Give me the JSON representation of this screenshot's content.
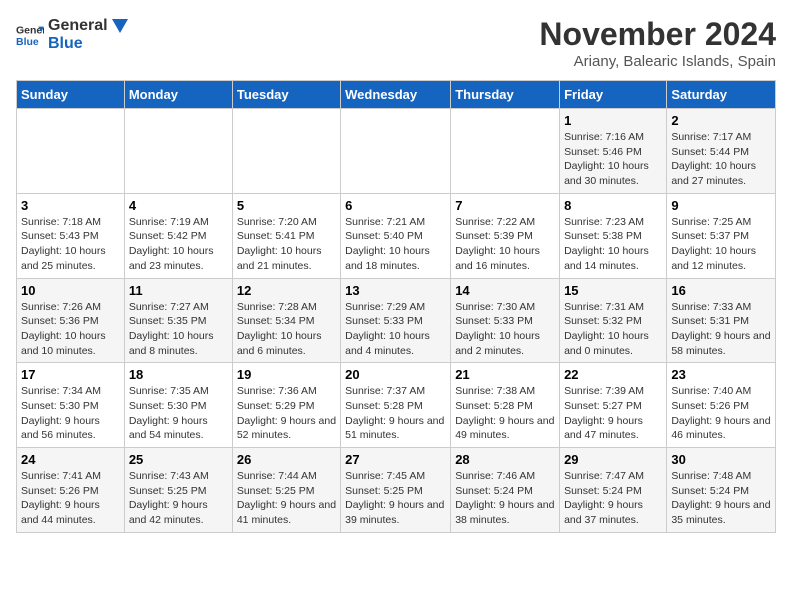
{
  "header": {
    "logo_general": "General",
    "logo_blue": "Blue",
    "month_year": "November 2024",
    "location": "Ariany, Balearic Islands, Spain"
  },
  "calendar": {
    "days_of_week": [
      "Sunday",
      "Monday",
      "Tuesday",
      "Wednesday",
      "Thursday",
      "Friday",
      "Saturday"
    ],
    "weeks": [
      [
        {
          "day": "",
          "info": ""
        },
        {
          "day": "",
          "info": ""
        },
        {
          "day": "",
          "info": ""
        },
        {
          "day": "",
          "info": ""
        },
        {
          "day": "",
          "info": ""
        },
        {
          "day": "1",
          "info": "Sunrise: 7:16 AM\nSunset: 5:46 PM\nDaylight: 10 hours and 30 minutes."
        },
        {
          "day": "2",
          "info": "Sunrise: 7:17 AM\nSunset: 5:44 PM\nDaylight: 10 hours and 27 minutes."
        }
      ],
      [
        {
          "day": "3",
          "info": "Sunrise: 7:18 AM\nSunset: 5:43 PM\nDaylight: 10 hours and 25 minutes."
        },
        {
          "day": "4",
          "info": "Sunrise: 7:19 AM\nSunset: 5:42 PM\nDaylight: 10 hours and 23 minutes."
        },
        {
          "day": "5",
          "info": "Sunrise: 7:20 AM\nSunset: 5:41 PM\nDaylight: 10 hours and 21 minutes."
        },
        {
          "day": "6",
          "info": "Sunrise: 7:21 AM\nSunset: 5:40 PM\nDaylight: 10 hours and 18 minutes."
        },
        {
          "day": "7",
          "info": "Sunrise: 7:22 AM\nSunset: 5:39 PM\nDaylight: 10 hours and 16 minutes."
        },
        {
          "day": "8",
          "info": "Sunrise: 7:23 AM\nSunset: 5:38 PM\nDaylight: 10 hours and 14 minutes."
        },
        {
          "day": "9",
          "info": "Sunrise: 7:25 AM\nSunset: 5:37 PM\nDaylight: 10 hours and 12 minutes."
        }
      ],
      [
        {
          "day": "10",
          "info": "Sunrise: 7:26 AM\nSunset: 5:36 PM\nDaylight: 10 hours and 10 minutes."
        },
        {
          "day": "11",
          "info": "Sunrise: 7:27 AM\nSunset: 5:35 PM\nDaylight: 10 hours and 8 minutes."
        },
        {
          "day": "12",
          "info": "Sunrise: 7:28 AM\nSunset: 5:34 PM\nDaylight: 10 hours and 6 minutes."
        },
        {
          "day": "13",
          "info": "Sunrise: 7:29 AM\nSunset: 5:33 PM\nDaylight: 10 hours and 4 minutes."
        },
        {
          "day": "14",
          "info": "Sunrise: 7:30 AM\nSunset: 5:33 PM\nDaylight: 10 hours and 2 minutes."
        },
        {
          "day": "15",
          "info": "Sunrise: 7:31 AM\nSunset: 5:32 PM\nDaylight: 10 hours and 0 minutes."
        },
        {
          "day": "16",
          "info": "Sunrise: 7:33 AM\nSunset: 5:31 PM\nDaylight: 9 hours and 58 minutes."
        }
      ],
      [
        {
          "day": "17",
          "info": "Sunrise: 7:34 AM\nSunset: 5:30 PM\nDaylight: 9 hours and 56 minutes."
        },
        {
          "day": "18",
          "info": "Sunrise: 7:35 AM\nSunset: 5:30 PM\nDaylight: 9 hours and 54 minutes."
        },
        {
          "day": "19",
          "info": "Sunrise: 7:36 AM\nSunset: 5:29 PM\nDaylight: 9 hours and 52 minutes."
        },
        {
          "day": "20",
          "info": "Sunrise: 7:37 AM\nSunset: 5:28 PM\nDaylight: 9 hours and 51 minutes."
        },
        {
          "day": "21",
          "info": "Sunrise: 7:38 AM\nSunset: 5:28 PM\nDaylight: 9 hours and 49 minutes."
        },
        {
          "day": "22",
          "info": "Sunrise: 7:39 AM\nSunset: 5:27 PM\nDaylight: 9 hours and 47 minutes."
        },
        {
          "day": "23",
          "info": "Sunrise: 7:40 AM\nSunset: 5:26 PM\nDaylight: 9 hours and 46 minutes."
        }
      ],
      [
        {
          "day": "24",
          "info": "Sunrise: 7:41 AM\nSunset: 5:26 PM\nDaylight: 9 hours and 44 minutes."
        },
        {
          "day": "25",
          "info": "Sunrise: 7:43 AM\nSunset: 5:25 PM\nDaylight: 9 hours and 42 minutes."
        },
        {
          "day": "26",
          "info": "Sunrise: 7:44 AM\nSunset: 5:25 PM\nDaylight: 9 hours and 41 minutes."
        },
        {
          "day": "27",
          "info": "Sunrise: 7:45 AM\nSunset: 5:25 PM\nDaylight: 9 hours and 39 minutes."
        },
        {
          "day": "28",
          "info": "Sunrise: 7:46 AM\nSunset: 5:24 PM\nDaylight: 9 hours and 38 minutes."
        },
        {
          "day": "29",
          "info": "Sunrise: 7:47 AM\nSunset: 5:24 PM\nDaylight: 9 hours and 37 minutes."
        },
        {
          "day": "30",
          "info": "Sunrise: 7:48 AM\nSunset: 5:24 PM\nDaylight: 9 hours and 35 minutes."
        }
      ]
    ]
  }
}
